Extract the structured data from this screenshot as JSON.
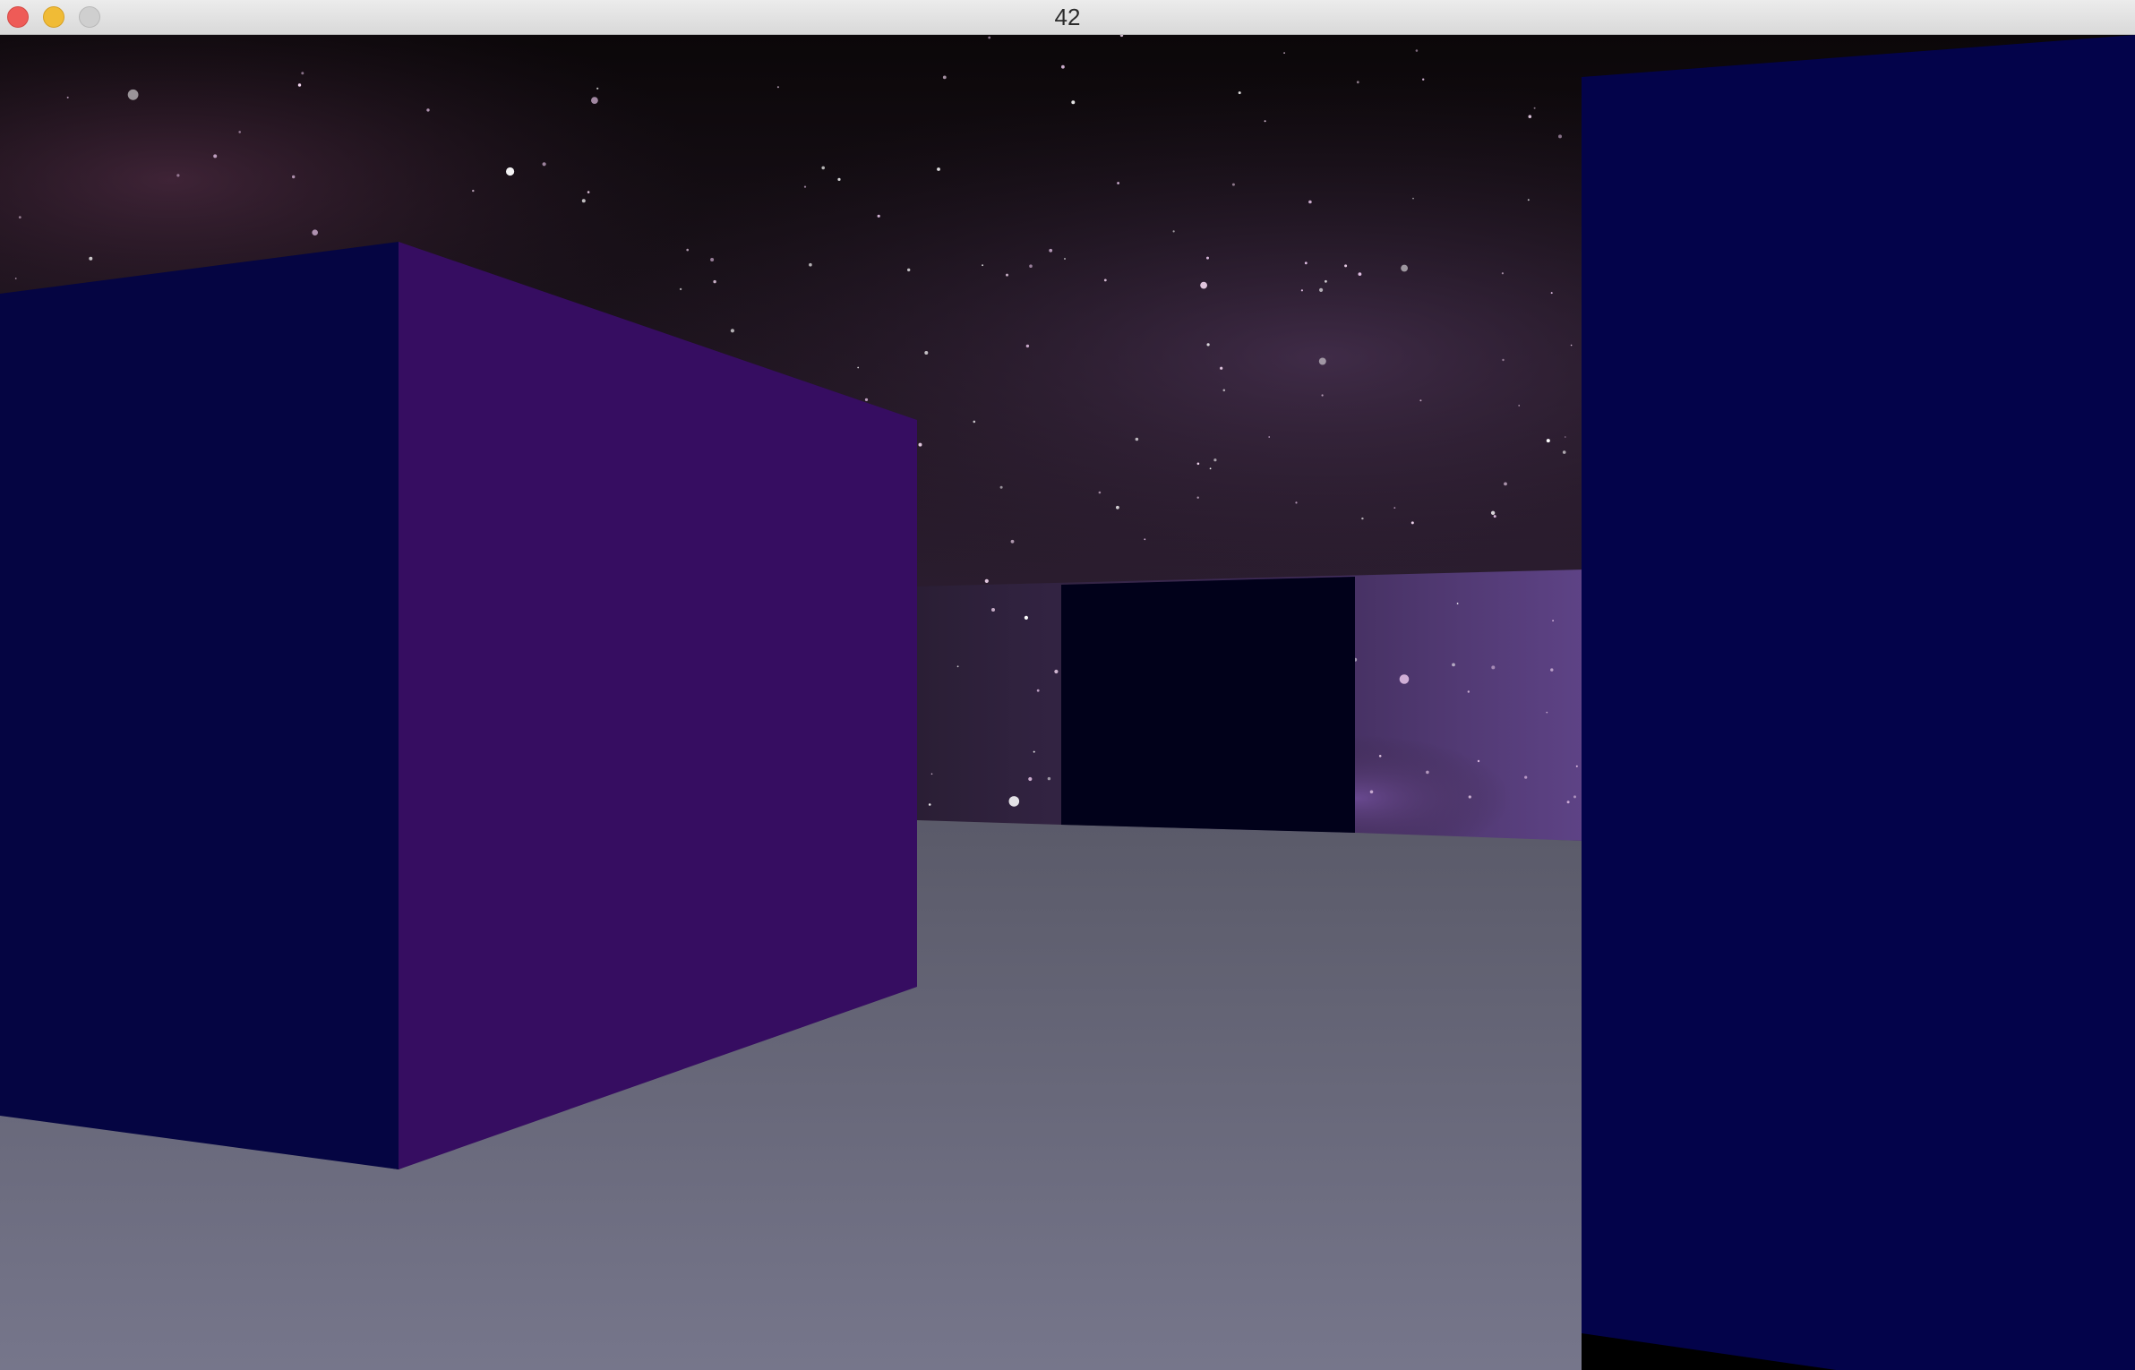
{
  "window": {
    "title": "42",
    "buttons": {
      "close": "close-button",
      "minimize": "minimize-button",
      "zoom": "zoom-button"
    }
  },
  "scene": {
    "type": "raycaster-3d-view",
    "colors": {
      "sky_top": "#0d090c",
      "sky_mid": "#2b1e2c",
      "nebula": "#6a4a86",
      "floor_far": "#5b5b6a",
      "floor_near": "#74748a",
      "wall_dark_navy": "#050542",
      "wall_purple": "#360d61",
      "wall_far": "#01011a",
      "wall_right": "#03034a"
    }
  }
}
